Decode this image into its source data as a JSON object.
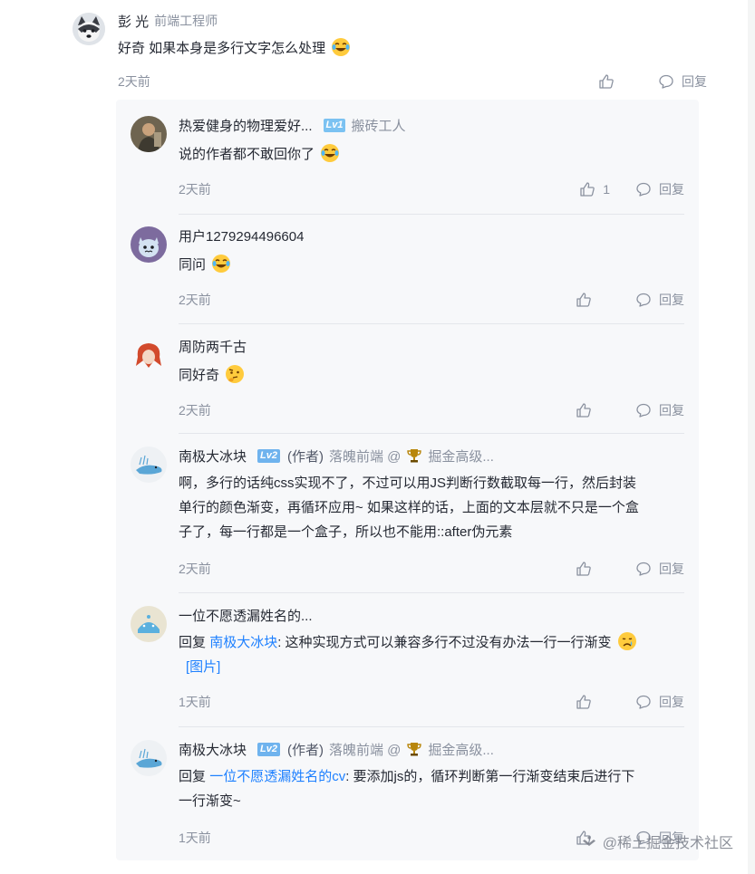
{
  "root_comment": {
    "username": "彭 光",
    "job_title": "前端工程师",
    "content": "好奇 如果本身是多行文字怎么处理",
    "emoji": "laughing-tears",
    "time": "2天前",
    "reply_label": "回复"
  },
  "replies": [
    {
      "username": "热爱健身的物理爱好...",
      "level": "Lv1",
      "job_title": "搬砖工人",
      "content": "说的作者都不敢回你了",
      "emoji": "laughing-tears",
      "time": "2天前",
      "like_count": "1",
      "reply_label": "回复"
    },
    {
      "username": "用户1279294496604",
      "content": "同问",
      "emoji": "laughing-tears",
      "time": "2天前",
      "reply_label": "回复"
    },
    {
      "username": "周防两千古",
      "content": "同好奇",
      "emoji": "thinking",
      "time": "2天前",
      "reply_label": "回复"
    },
    {
      "username": "南极大冰块",
      "level": "Lv2",
      "author_tag": "(作者)",
      "company": "落魄前端 @",
      "badge": "掘金高级...",
      "content_lines": [
        "啊，多行的话纯css实现不了，不过可以用JS判断行数截取每一行，然后封装",
        "单行的颜色渐变，再循环应用~ 如果这样的话，上面的文本层就不只是一个盒",
        "子了，每一行都是一个盒子，所以也不能用::after伪元素"
      ],
      "time": "2天前",
      "reply_label": "回复"
    },
    {
      "username": "一位不愿透漏姓名的...",
      "reply_prefix": "回复",
      "reply_to": "南极大冰块",
      "content": ": 这种实现方式可以兼容多行不过没有办法一行一行渐变",
      "emoji": "crying",
      "image_link": "[图片]",
      "time": "1天前",
      "reply_label": "回复"
    },
    {
      "username": "南极大冰块",
      "level": "Lv2",
      "author_tag": "(作者)",
      "company": "落魄前端 @",
      "badge": "掘金高级...",
      "reply_prefix": "回复",
      "reply_to": "一位不愿透漏姓名的cv",
      "content": ": 要添加js的，循环判断第一行渐变结束后进行下",
      "content_line2": "一行渐变~",
      "time": "1天前",
      "reply_label": "回复"
    }
  ],
  "watermark": "@稀土掘金技术社区"
}
